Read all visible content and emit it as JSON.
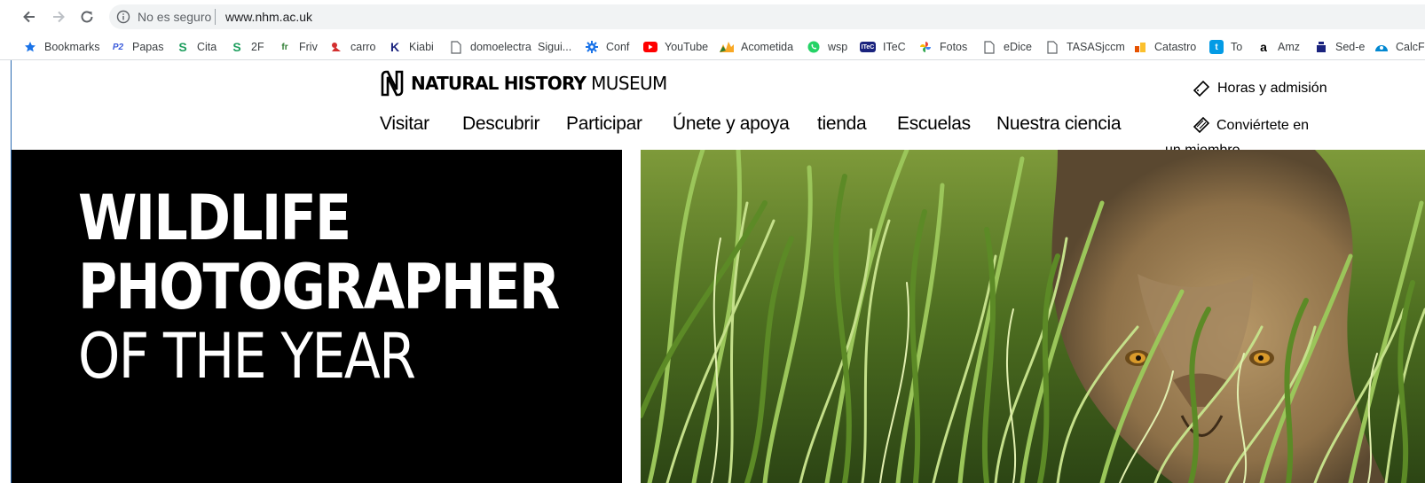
{
  "browser": {
    "security_label": "No es seguro",
    "url": "www.nhm.ac.uk"
  },
  "bookmarks": [
    {
      "label": "Bookmarks",
      "icon": "star-icon",
      "color": "#1a73e8"
    },
    {
      "label": "Papas",
      "icon": "p2-icon",
      "color": "#3b5bdb"
    },
    {
      "label": "Cita",
      "icon": "s-logo-icon",
      "color": "#1e9e5e"
    },
    {
      "label": "2F",
      "icon": "s-logo-icon",
      "color": "#1e9e5e"
    },
    {
      "label": "Friv",
      "icon": "friv-icon",
      "color": "#2e7d32"
    },
    {
      "label": "carro",
      "icon": "carro-icon",
      "color": "#d32f2f"
    },
    {
      "label": "Kiabi",
      "icon": "kiabi-icon",
      "color": "#1a237e"
    },
    {
      "label": "domoelectra",
      "icon": "page-icon",
      "color": "#5f6368"
    },
    {
      "label": "Sigui...",
      "icon": "none",
      "color": "#5f6368"
    },
    {
      "label": "Conf",
      "icon": "gear-icon",
      "color": "#1a73e8"
    },
    {
      "label": "YouTube",
      "icon": "youtube-icon",
      "color": "#ff0000"
    },
    {
      "label": "Acometida",
      "icon": "acometida-icon",
      "color": "#f9a825"
    },
    {
      "label": "wsp",
      "icon": "whatsapp-icon",
      "color": "#25d366"
    },
    {
      "label": "ITeC",
      "icon": "itec-icon",
      "color": "#1a237e"
    },
    {
      "label": "Fotos",
      "icon": "photos-icon",
      "color": "#ea4335"
    },
    {
      "label": "eDice",
      "icon": "page-icon",
      "color": "#5f6368"
    },
    {
      "label": "TASASjccm",
      "icon": "page-icon",
      "color": "#5f6368"
    },
    {
      "label": "Catastro",
      "icon": "catastro-icon",
      "color": "#e65100"
    },
    {
      "label": "To",
      "icon": "to-icon",
      "color": "#039be5"
    },
    {
      "label": "Amz",
      "icon": "amazon-icon",
      "color": "#000000"
    },
    {
      "label": "Sed-e",
      "icon": "sede-icon",
      "color": "#1a237e"
    },
    {
      "label": "CalcFr",
      "icon": "calc-icon",
      "color": "#0288d1"
    }
  ],
  "site": {
    "logo_bold": "NATURAL HISTORY",
    "logo_light": "MUSEUM",
    "nav": [
      {
        "label": "Visitar"
      },
      {
        "label": "Descubrir"
      },
      {
        "label": "Participar"
      },
      {
        "label": "Únete y apoya"
      },
      {
        "label": "tienda"
      },
      {
        "label": "Escuelas"
      },
      {
        "label": "Nuestra ciencia"
      }
    ],
    "util": {
      "hours": "Horas y admisión",
      "member": "Conviértete en un miembro"
    }
  },
  "hero": {
    "line1": "WILDLIFE",
    "line2": "PHOTOGRAPHER",
    "line3": "OF THE YEAR"
  }
}
